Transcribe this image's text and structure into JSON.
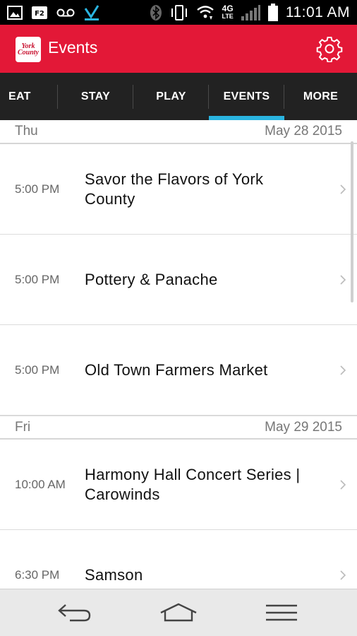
{
  "status_bar": {
    "time": "11:01 AM",
    "network": "4G",
    "network_sub": "LTE",
    "icons": [
      "image-icon",
      "f2-icon",
      "voicemail-icon",
      "check-icon",
      "bluetooth-icon",
      "vibrate-icon",
      "wifi-icon",
      "signal-icon",
      "battery-icon"
    ]
  },
  "app_bar": {
    "title": "Events",
    "logo_line1": "York",
    "logo_line2": "County",
    "accent_color": "#e31837"
  },
  "tabs": [
    {
      "label": "EAT",
      "active": false
    },
    {
      "label": "STAY",
      "active": false
    },
    {
      "label": "PLAY",
      "active": false
    },
    {
      "label": "EVENTS",
      "active": true
    },
    {
      "label": "MORE",
      "active": false
    }
  ],
  "tab_indicator_color": "#2ab4e0",
  "days": [
    {
      "day": "Thu",
      "date": "May 28 2015",
      "events": [
        {
          "time": "5:00 PM",
          "title": "Savor the Flavors of York County"
        },
        {
          "time": "5:00 PM",
          "title": "Pottery & Panache"
        },
        {
          "time": "5:00 PM",
          "title": "Old Town Farmers Market"
        }
      ]
    },
    {
      "day": "Fri",
      "date": "May 29 2015",
      "events": [
        {
          "time": "10:00 AM",
          "title": "Harmony Hall Concert Series | Carowinds"
        },
        {
          "time": "6:30 PM",
          "title": "Samson"
        }
      ]
    }
  ],
  "nav_bar": {
    "buttons": [
      "back-icon",
      "home-icon",
      "menu-icon"
    ]
  }
}
